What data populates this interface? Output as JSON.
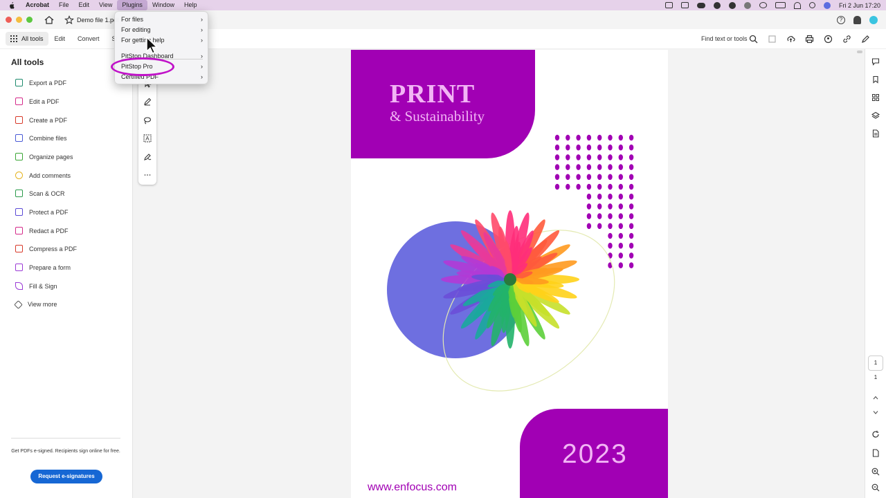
{
  "menubar": {
    "app": "Acrobat",
    "items": [
      "File",
      "Edit",
      "View",
      "Plugins",
      "Window",
      "Help"
    ],
    "active": "Plugins",
    "clock": "Fri 2 Jun  17:20"
  },
  "tab": {
    "title": "Demo file 1.pdf"
  },
  "toolbar": {
    "all_tools": "All tools",
    "edit": "Edit",
    "convert": "Convert",
    "sign_partial": "Si",
    "find": "Find text or tools"
  },
  "left_panel": {
    "title": "All tools",
    "items": [
      {
        "label": "Export a PDF",
        "color": "#1d8a6c"
      },
      {
        "label": "Edit a PDF",
        "color": "#d52a8a"
      },
      {
        "label": "Create a PDF",
        "color": "#d83a2a"
      },
      {
        "label": "Combine files",
        "color": "#4a5bd6"
      },
      {
        "label": "Organize pages",
        "color": "#3aa635"
      },
      {
        "label": "Add comments",
        "color": "#e5b21b"
      },
      {
        "label": "Scan & OCR",
        "color": "#2a9a4a"
      },
      {
        "label": "Protect a PDF",
        "color": "#5b4ad6"
      },
      {
        "label": "Redact a PDF",
        "color": "#d52a8a"
      },
      {
        "label": "Compress a PDF",
        "color": "#d83a2a"
      },
      {
        "label": "Prepare a form",
        "color": "#9b3ad6"
      },
      {
        "label": "Fill & Sign",
        "color": "#9b3ad6"
      },
      {
        "label": "View more",
        "color": "#555555"
      }
    ],
    "esign_text": "Get PDFs e-signed. Recipients sign online for free.",
    "esign_button": "Request e-signatures"
  },
  "plugin_menu": {
    "items": [
      {
        "label": "For files"
      },
      {
        "label": "For editing"
      },
      {
        "label": "For getting help"
      },
      {
        "label": "PitStop Dashboard"
      },
      {
        "label": "PitStop Pro"
      },
      {
        "label": "Certified PDF"
      }
    ],
    "highlighted": "PitStop Pro"
  },
  "pdf": {
    "title_line1": "PRINT",
    "title_line2": "& Sustainability",
    "year": "2023",
    "url": "www.enfocus.com",
    "colors": {
      "brand": "#a100b4",
      "title": "#f2b5f5",
      "circle": "#6e6fe0"
    }
  },
  "right_rail": {
    "page_current": "1",
    "page_total": "1"
  }
}
